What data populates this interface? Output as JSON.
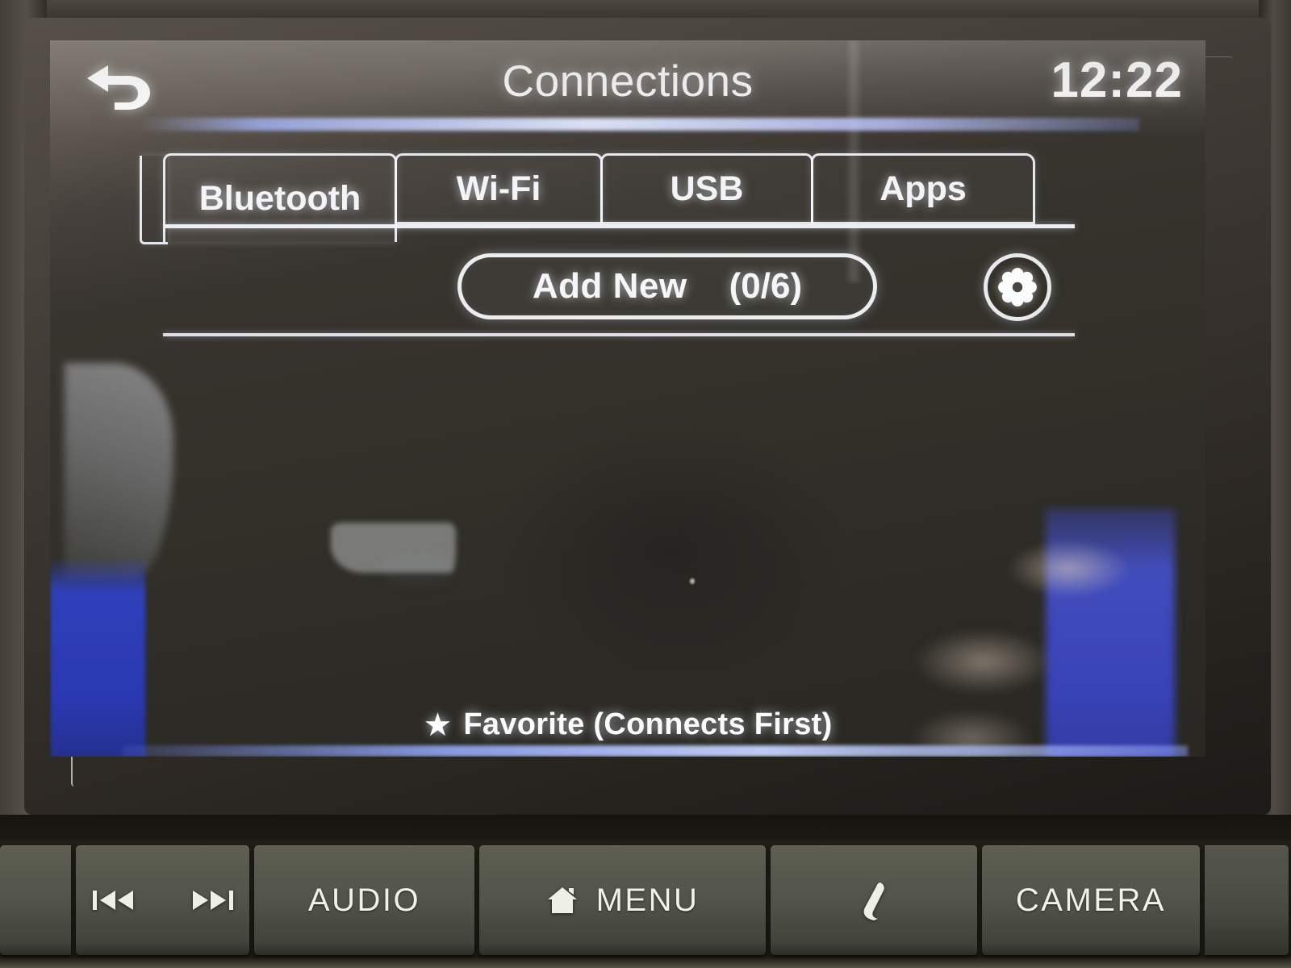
{
  "screen": {
    "header": {
      "back_icon": "back-arrow-icon",
      "title": "Connections",
      "clock": "12:22"
    },
    "tabs": [
      {
        "label": "Bluetooth",
        "active": true
      },
      {
        "label": "Wi-Fi",
        "active": false
      },
      {
        "label": "USB",
        "active": false
      },
      {
        "label": "Apps",
        "active": false
      }
    ],
    "toolbar": {
      "add_new_label": "Add New",
      "add_new_count": "(0/6)",
      "paired_count": 0,
      "max_devices": 6,
      "settings_icon": "gear-icon"
    },
    "device_list": {
      "items": [],
      "empty": true
    },
    "footer": {
      "favorite_star_icon": "star-icon",
      "favorite_legend": "Favorite (Connects First)"
    },
    "colors": {
      "ui_text": "#f5f6f9",
      "screen_bg": "#332f2a",
      "glare_blue": "#3040c8",
      "bezel": "#433d38"
    }
  },
  "hardware_buttons": [
    {
      "label": "",
      "icon": "prev-track-icon",
      "name": "prev-track-button"
    },
    {
      "label": "",
      "icon": "next-track-icon",
      "name": "next-track-button"
    },
    {
      "label": "AUDIO",
      "icon": "",
      "name": "audio-button"
    },
    {
      "label": "MENU",
      "icon": "home-icon",
      "name": "menu-button"
    },
    {
      "label": "",
      "icon": "phone-handset-icon",
      "name": "phone-button"
    },
    {
      "label": "CAMERA",
      "icon": "",
      "name": "camera-button"
    }
  ]
}
